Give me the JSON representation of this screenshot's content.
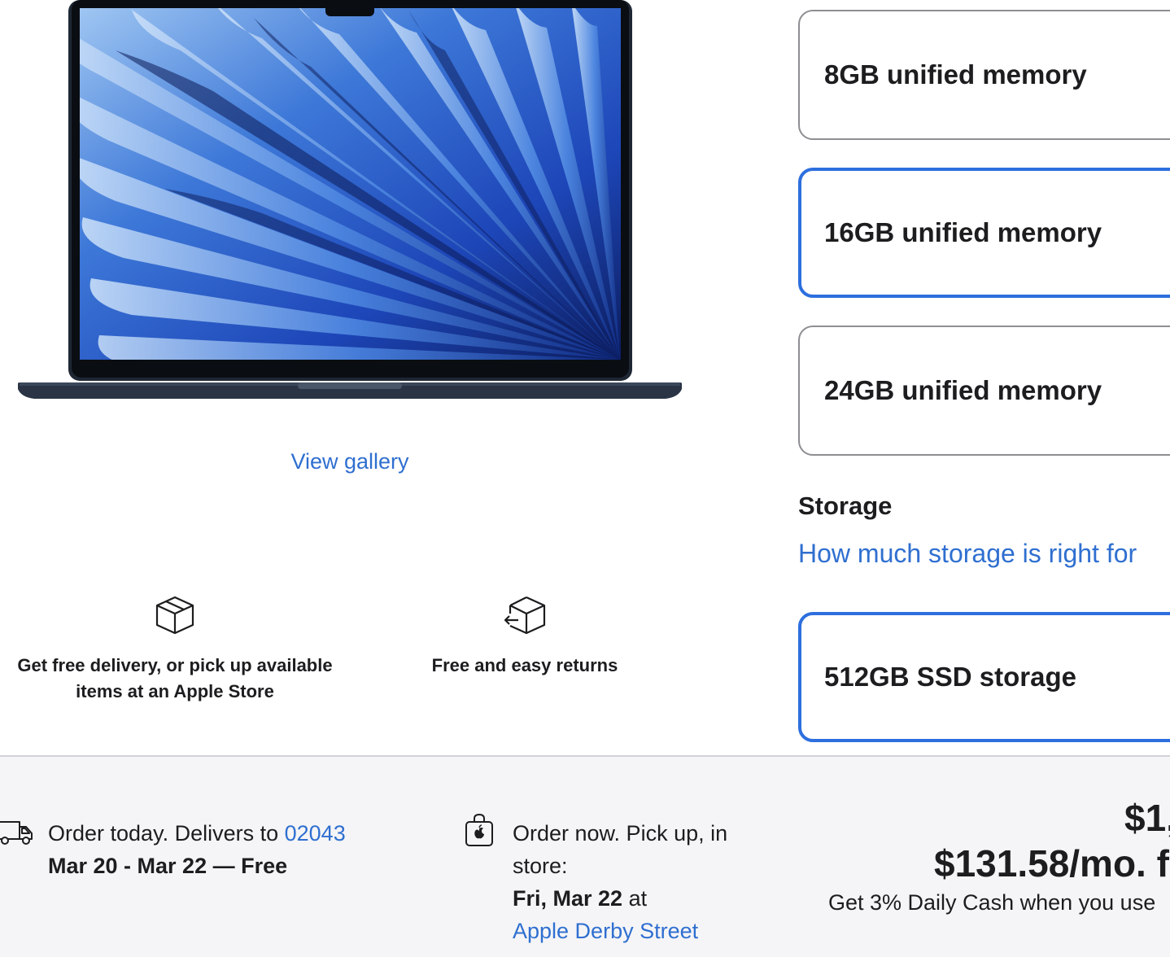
{
  "gallery": {
    "view_label": "View gallery"
  },
  "features": {
    "delivery_text": "Get free delivery, or pick up available items at an Apple Store",
    "returns_text": "Free and easy returns"
  },
  "memory": {
    "options": [
      {
        "label": "8GB unified memory",
        "selected": false
      },
      {
        "label": "16GB unified memory",
        "selected": true
      },
      {
        "label": "24GB unified memory",
        "selected": false
      }
    ]
  },
  "storage": {
    "heading": "Storage",
    "help_link": "How much storage is right for",
    "options": [
      {
        "label": "512GB SSD storage",
        "selected": true
      }
    ]
  },
  "order": {
    "delivery_prefix": "Order today. Delivers to",
    "zip": "02043",
    "delivery_dates": "Mar 20 - Mar 22 — Free",
    "pickup_prefix": "Order now. Pick up, in store:",
    "pickup_date": "Fri, Mar 22",
    "pickup_at": "at",
    "pickup_store": "Apple Derby Street"
  },
  "price": {
    "main": "$1,",
    "monthly": "$131.58/mo. f",
    "cash_note": "Get 3% Daily Cash when you use"
  },
  "colors": {
    "accent": "#2d6fde",
    "link": "#2f6fd0",
    "bottom_bg": "#f5f5f7"
  }
}
